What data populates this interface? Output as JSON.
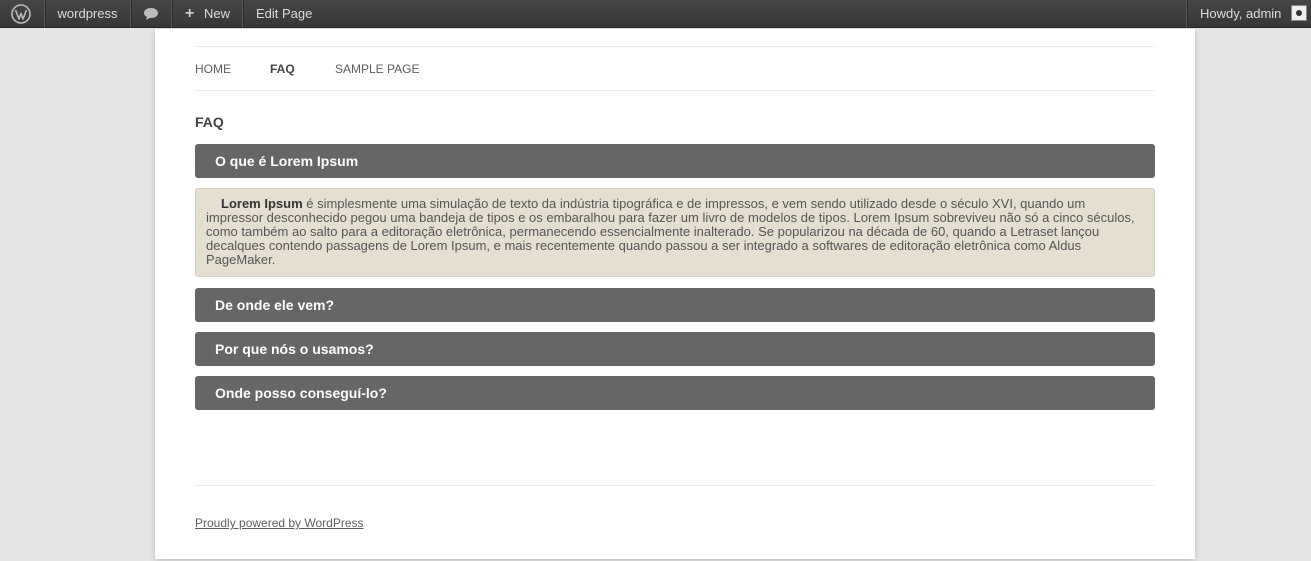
{
  "adminbar": {
    "logo_icon": "wordpress-logo-icon",
    "site_name": "wordpress",
    "comments_icon": "comment-bubble-icon",
    "new_icon": "plus-icon",
    "new_label": "New",
    "edit_label": "Edit Page",
    "howdy": "Howdy, admin",
    "avatar_icon": "avatar-icon"
  },
  "nav": {
    "items": [
      {
        "label": "HOME"
      },
      {
        "label": "FAQ",
        "current": true
      },
      {
        "label": "SAMPLE PAGE"
      }
    ]
  },
  "page": {
    "title": "FAQ"
  },
  "accordion": {
    "items": [
      {
        "title": "O que é Lorem Ipsum",
        "expanded": true
      },
      {
        "title": "De onde ele vem?"
      },
      {
        "title": "Por que nós o usamos?"
      },
      {
        "title": "Onde posso conseguí-lo?"
      }
    ],
    "panel": {
      "lead": "Lorem Ipsum",
      "body": " é simplesmente uma simulação de texto da indústria tipográfica e de impressos, e vem sendo utilizado desde o século XVI, quando um impressor desconhecido pegou uma bandeja de tipos e os embaralhou para fazer um livro de modelos de tipos. Lorem Ipsum sobreviveu não só a cinco séculos, como também ao salto para a editoração eletrônica, permanecendo essencialmente inalterado. Se popularizou na década de 60, quando a Letraset lançou decalques contendo passagens de Lorem Ipsum, e mais recentemente quando passou a ser integrado a softwares de editoração eletrônica como Aldus PageMaker."
    }
  },
  "footer": {
    "credit": "Proudly powered by WordPress"
  },
  "colors": {
    "adminbar_bg": "#464646",
    "accordion_header": "#666666",
    "panel_bg": "#e4dfd0",
    "page_bg": "#e6e6e6"
  }
}
